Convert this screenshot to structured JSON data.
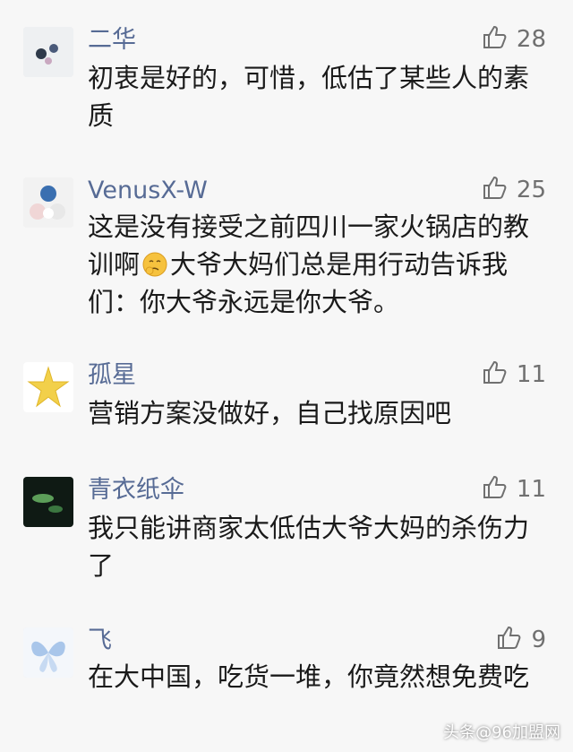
{
  "comments": [
    {
      "name": "二华",
      "likes": "28",
      "text": "初衷是好的，可惜，低估了某些人的素质"
    },
    {
      "name": "VenusX-W",
      "likes": "25",
      "text_before_emoji": "这是没有接受之前四川一家火锅店的教训啊",
      "text_after_emoji": "大爷大妈们总是用行动告诉我们：你大爷永远是你大爷。"
    },
    {
      "name": "孤星",
      "likes": "11",
      "text": "营销方案没做好，自己找原因吧"
    },
    {
      "name": "青衣纸伞",
      "likes": "11",
      "text": "我只能讲商家太低估大爷大妈的杀伤力了"
    },
    {
      "name": "飞",
      "likes": "9",
      "text": "在大中国，吃货一堆，你竟然想免费吃"
    }
  ],
  "watermark": "头条@96加盟网",
  "colors": {
    "name": "#576b95",
    "text": "#1a1a1a",
    "likes": "#707070",
    "background": "#f7f7f7"
  },
  "icons": {
    "like": "thumbs-up-icon",
    "emoji": "thinking-face-emoji"
  }
}
